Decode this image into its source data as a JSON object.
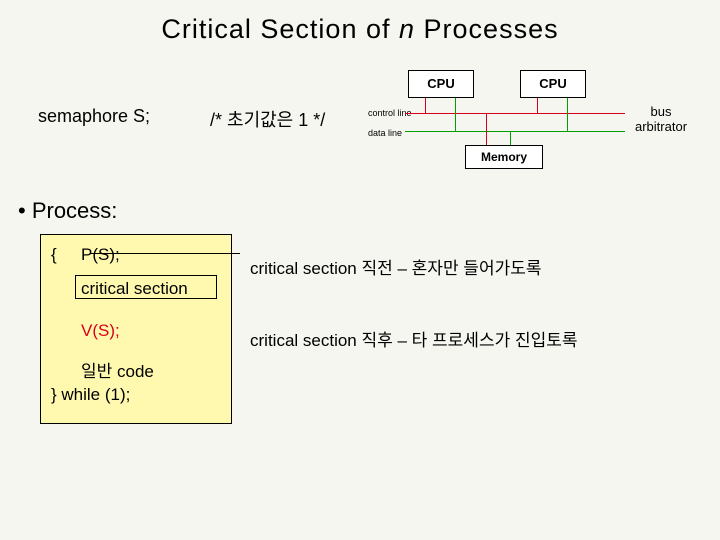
{
  "title_pre": "Critical Section of ",
  "title_n": "n",
  "title_post": " Processes",
  "diagram": {
    "cpu1": "CPU",
    "cpu2": "CPU",
    "control_label": "control line",
    "data_label": "data line",
    "bus_label": "bus\narbitrator",
    "memory": "Memory"
  },
  "left": {
    "sem_decl": "semaphore S;",
    "init_comment": "/* 초기값은 1 */",
    "bullet": "• Process:"
  },
  "code": {
    "brace_open": "{",
    "ps": "P(S);",
    "cs": "critical section",
    "vs": "V(S);",
    "general": "일반 code",
    "while": "} while (1);"
  },
  "explain": {
    "e1": "critical section 직전 – 혼자만 들어가도록",
    "e2": "critical section 직후 – 타 프로세스가 진입토록"
  }
}
